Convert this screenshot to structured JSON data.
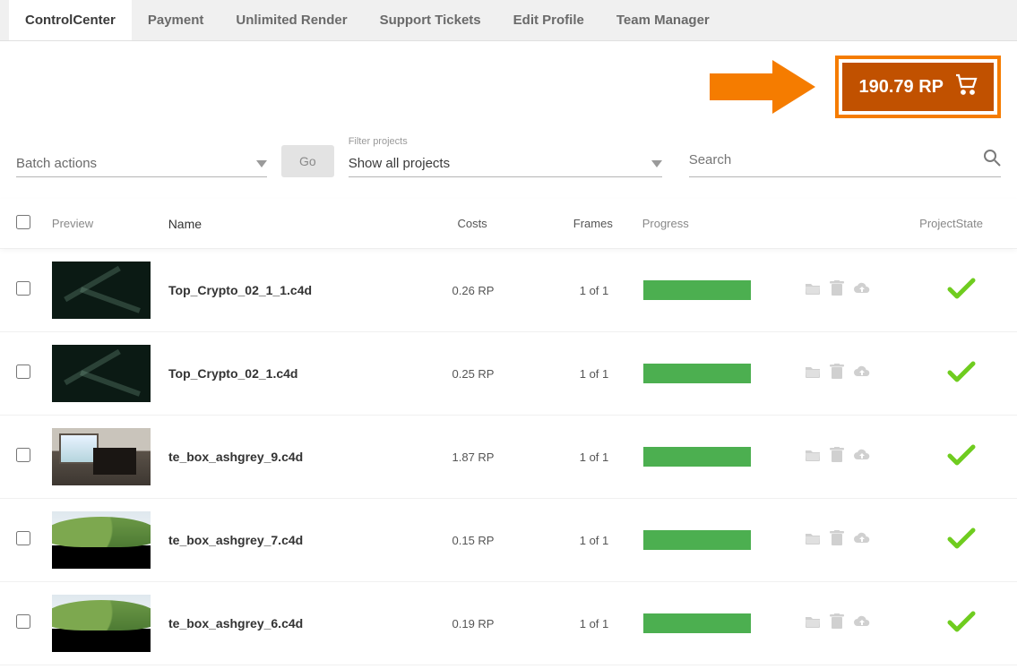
{
  "tabs": [
    "ControlCenter",
    "Payment",
    "Unlimited Render",
    "Support Tickets",
    "Edit Profile",
    "Team Manager"
  ],
  "activeTabIndex": 0,
  "credits": {
    "display": "190.79 RP"
  },
  "batch": {
    "placeholder": "Batch actions",
    "go": "Go"
  },
  "filter": {
    "label": "Filter projects",
    "value": "Show all projects"
  },
  "search": {
    "placeholder": "Search"
  },
  "headers": {
    "preview": "Preview",
    "name": "Name",
    "costs": "Costs",
    "frames": "Frames",
    "progress": "Progress",
    "state": "ProjectState"
  },
  "rows": [
    {
      "name": "Top_Crypto_02_1_1.c4d",
      "costs": "0.26 RP",
      "frames": "1 of 1",
      "thumb": "dark"
    },
    {
      "name": "Top_Crypto_02_1.c4d",
      "costs": "0.25 RP",
      "frames": "1 of 1",
      "thumb": "dark"
    },
    {
      "name": "te_box_ashgrey_9.c4d",
      "costs": "1.87 RP",
      "frames": "1 of 1",
      "thumb": "room"
    },
    {
      "name": "te_box_ashgrey_7.c4d",
      "costs": "0.15 RP",
      "frames": "1 of 1",
      "thumb": "hill"
    },
    {
      "name": "te_box_ashgrey_6.c4d",
      "costs": "0.19 RP",
      "frames": "1 of 1",
      "thumb": "hill"
    }
  ]
}
